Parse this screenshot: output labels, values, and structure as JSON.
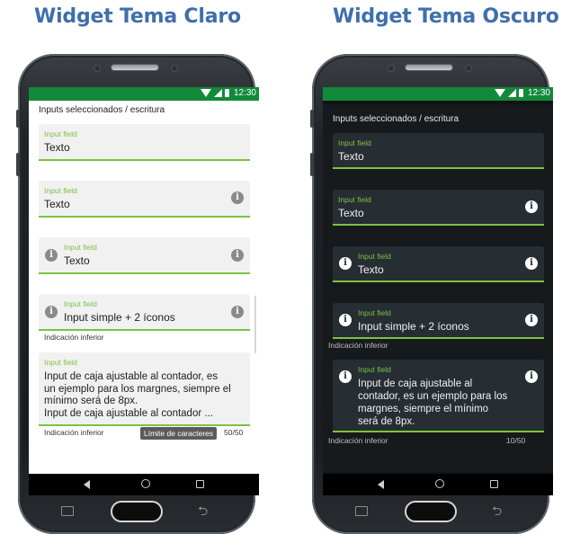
{
  "headings": {
    "light": "Widget Tema Claro",
    "dark": "Widget Tema Oscuro"
  },
  "status": {
    "time": "12:30"
  },
  "section_title": "Inputs seleccionados / escritura",
  "fields": [
    {
      "label": "Input field",
      "value": "Texto"
    },
    {
      "label": "Input field",
      "value": "Texto",
      "trailing_icon": "info-icon"
    },
    {
      "label": "Input field",
      "value": "Texto",
      "leading_icon": "info-icon",
      "trailing_icon": "info-icon"
    },
    {
      "label": "Input field",
      "value": "Input simple + 2 íconos",
      "leading_icon": "info-icon",
      "trailing_icon": "info-icon",
      "hint": "Indicación inferior"
    }
  ],
  "textarea_light": {
    "label": "Input field",
    "lines": [
      "Input de caja ajustable al contador, es",
      "un ejemplo para los margnes, siempre el",
      "mínimo será de 8px.",
      "Input de caja ajustable al contador ..."
    ],
    "hint": "Indicación inferior",
    "tooltip": "Límite de caracteres",
    "counter": "50/50"
  },
  "textarea_dark": {
    "label": "Input field",
    "lines": [
      "Input de caja ajustable al",
      "contador, es un ejemplo para los",
      "margnes, siempre el mínimo",
      "será de 8px."
    ],
    "hint": "Indicación inferior",
    "counter": "10/50"
  },
  "icons": {
    "info": "i",
    "hw_back": "⮌"
  },
  "colors": {
    "status_bar": "#118a3a",
    "accent": "#7bc342",
    "heading": "#3f6fab",
    "dark_field": "#262d33"
  }
}
